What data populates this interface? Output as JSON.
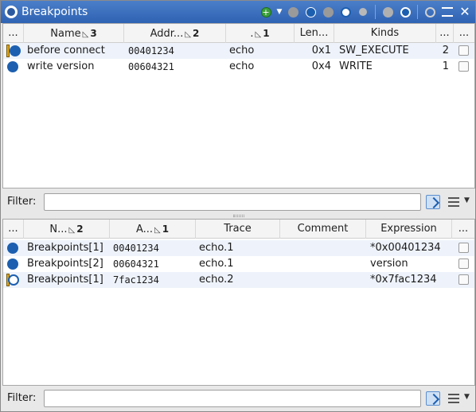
{
  "window": {
    "title": "Breakpoints"
  },
  "toolbar": {
    "icons": [
      "add-breakpoint-icon",
      "dropdown-arrow-icon",
      "disabled-breakpoint-icon",
      "enabled-breakpoint-icon",
      "disabled-breakpoint-icon",
      "breakpoint-refresh-icon",
      "watch-icon",
      "disable-all-icon",
      "remove-all-icon",
      "zoom-icon",
      "settings-icon",
      "close-icon"
    ],
    "close_label": "✕"
  },
  "breakpoints_table": {
    "columns": [
      {
        "label": "...",
        "sort": ""
      },
      {
        "label": "Name",
        "sort": "3"
      },
      {
        "label": "Addr...",
        "sort": "2"
      },
      {
        "label": ".",
        "sort": "1"
      },
      {
        "label": "Len...",
        "sort": ""
      },
      {
        "label": "Kinds",
        "sort": ""
      },
      {
        "label": "...",
        "sort": ""
      },
      {
        "label": "...",
        "sort": ""
      }
    ],
    "rows": [
      {
        "status": "enabled-warning",
        "name": "before connect",
        "address": "00401234",
        "module": "echo",
        "length": "0x1",
        "kind": "SW_EXECUTE",
        "count": "2",
        "checked": false
      },
      {
        "status": "enabled",
        "name": "write version",
        "address": "00604321",
        "module": "echo",
        "length": "0x4",
        "kind": "WRITE",
        "count": "1",
        "checked": false
      }
    ]
  },
  "filter1": {
    "label": "Filter:",
    "value": "",
    "placeholder": ""
  },
  "locations_table": {
    "columns": [
      {
        "label": "...",
        "sort": ""
      },
      {
        "label": "N...",
        "sort": "2"
      },
      {
        "label": "A...",
        "sort": "1"
      },
      {
        "label": "Trace",
        "sort": ""
      },
      {
        "label": "Comment",
        "sort": ""
      },
      {
        "label": "Expression",
        "sort": ""
      },
      {
        "label": "...",
        "sort": ""
      }
    ],
    "rows": [
      {
        "status": "enabled",
        "name": "Breakpoints[1]",
        "address": "00401234",
        "trace": "echo.1",
        "comment": "",
        "expression": "*0x00401234",
        "checked": false
      },
      {
        "status": "enabled",
        "name": "Breakpoints[2]",
        "address": "00604321",
        "trace": "echo.1",
        "comment": "",
        "expression": "version",
        "checked": false
      },
      {
        "status": "unresolved",
        "name": "Breakpoints[1]",
        "address": "7fac1234",
        "trace": "echo.2",
        "comment": "",
        "expression": "*0x7fac1234",
        "checked": false
      }
    ]
  },
  "filter2": {
    "label": "Filter:",
    "value": "",
    "placeholder": ""
  },
  "colors": {
    "titlebar": "#2f63b3",
    "breakpoint": "#1c5fb0",
    "warning": "#e6a818",
    "row_alt": "#eef3fb"
  }
}
